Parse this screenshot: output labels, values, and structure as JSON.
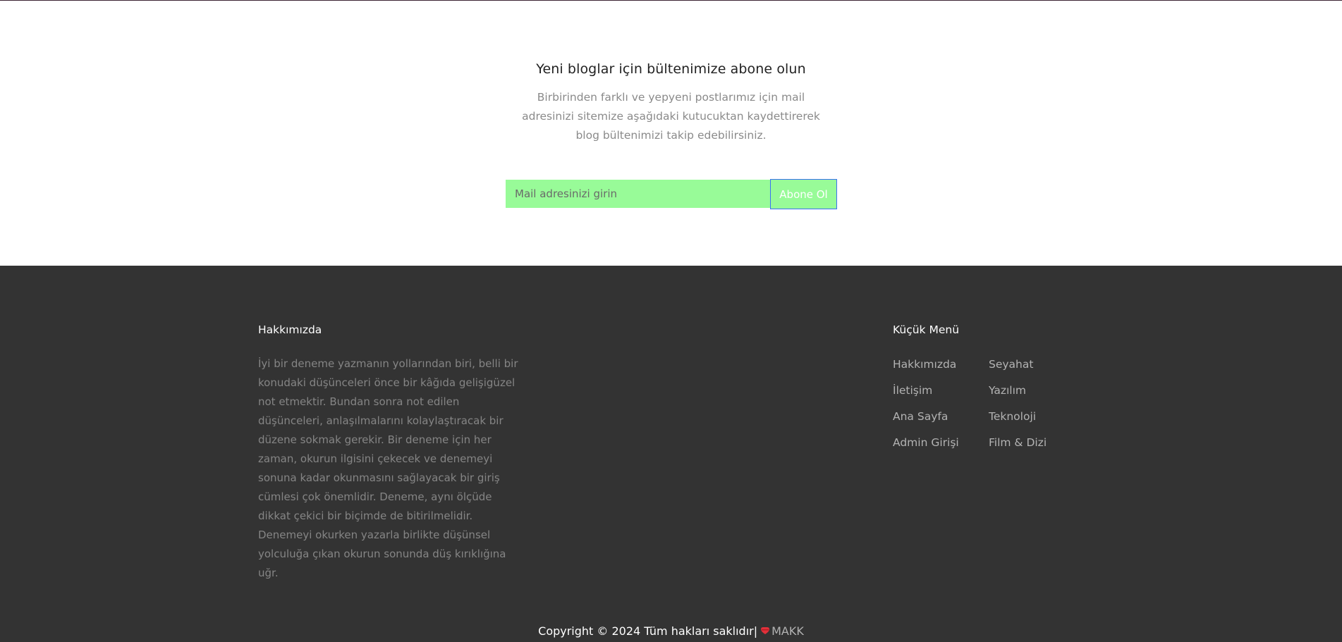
{
  "newsletter": {
    "title": "Yeni bloglar için bültenimize abone olun",
    "description": "Birbirinden farklı ve yepyeni postlarımız için mail adresinizi sitemize aşağıdaki kutucuktan kaydettirerek blog bültenimizi takip edebilirsiniz.",
    "email_placeholder": "Mail adresinizi girin",
    "subscribe_label": "Abone Ol",
    "accent_color": "#98fb98"
  },
  "footer": {
    "about": {
      "title": "Hakkımızda",
      "text": "İyi bir deneme yazmanın yollarından biri, belli bir konudaki düşünceleri önce bir kâğıda gelişigüzel not etmektir. Bundan sonra not edilen düşünceleri, anlaşılmalarını kolaylaştıracak bir düzene sokmak gerekir. Bir deneme için her zaman, okurun ilgisini çekecek ve denemeyi sonuna kadar okunmasını sağlayacak bir giriş cümlesi çok önemlidir. Deneme, aynı ölçüde dikkat çekici bir biçimde de bitirilmelidir. Denemeyi okurken yazarla birlikte düşünsel yolculuğa çıkan okurun sonunda düş kırıklığına uğr."
    },
    "menu": {
      "title": "Küçük Menü",
      "col1": [
        "Hakkımızda",
        "İletişim",
        "Ana Sayfa",
        "Admin Girişi"
      ],
      "col2": [
        "Seyahat",
        "Yazılım",
        "Teknoloji",
        "Film & Dizi"
      ]
    },
    "copyright": {
      "text": "Copyright © 2024 Tüm hakları saklıdır|",
      "icon": "heart-icon",
      "author": "MAKK"
    },
    "background_color": "#333333"
  }
}
